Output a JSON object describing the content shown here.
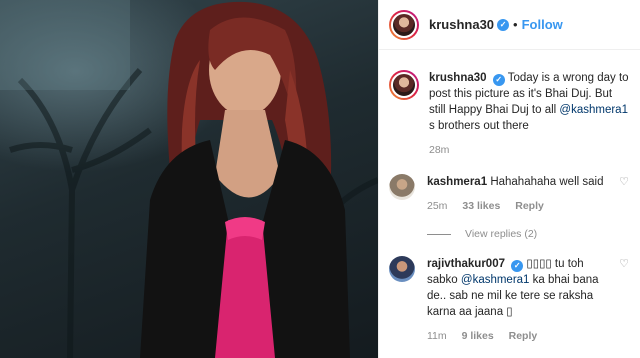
{
  "post": {
    "username": "krushna30",
    "follow_label": "Follow",
    "separator": "•",
    "verified_glyph": "✓",
    "caption": {
      "username": "krushna30",
      "text_before_mention": "Today is a wrong day to post this picture as it's Bhai Duj. But still Happy Bhai Duj to all ",
      "mention": "@kashmera1",
      "text_after_mention": " s brothers out there",
      "time": "28m"
    }
  },
  "comments": [
    {
      "username": "kashmera1",
      "text": "Hahahahaha well said",
      "time": "25m",
      "likes": "33 likes",
      "reply_label": "Reply",
      "view_replies": "View replies (2)"
    },
    {
      "username": "rajivthakur007",
      "text_before_mention": "▯▯▯▯ tu toh sabko ",
      "mention": "@kashmera1",
      "text_after_mention": " ka bhai bana de.. sab ne mil ke tere se raksha karna aa jaana ▯",
      "time": "11m",
      "likes": "9 likes",
      "reply_label": "Reply"
    }
  ],
  "icons": {
    "heart": "heart-icon",
    "verified": "verified-badge-icon"
  },
  "colors": {
    "accent": "#3897f0",
    "mention": "#00376b",
    "muted": "#8e8e8e",
    "text": "#262626"
  }
}
